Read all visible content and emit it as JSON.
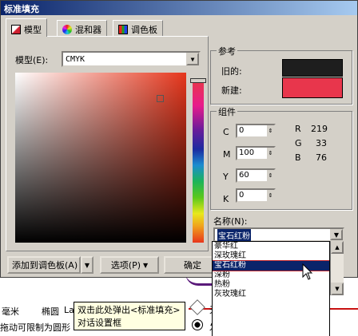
{
  "dialog": {
    "title": "标准填充",
    "tabs": [
      {
        "label": "模型",
        "icon": "model-square-icon"
      },
      {
        "label": "混和器",
        "icon": "mixer-wheel-icon"
      },
      {
        "label": "调色板",
        "icon": "palette-grid-icon"
      }
    ],
    "model": {
      "label": "模型(E):",
      "value": "CMYK",
      "field_base_color": "#e6361c",
      "picker_position": {
        "saturation": 0.82,
        "brightness": 0.85
      }
    },
    "reference": {
      "legend": "参考",
      "old_label": "旧的:",
      "old_color": "#1e1e1e",
      "new_label": "新建:",
      "new_color": "#e8364c"
    },
    "components": {
      "legend": "组件",
      "fields": [
        {
          "label": "C",
          "value": "0"
        },
        {
          "label": "M",
          "value": "100"
        },
        {
          "label": "Y",
          "value": "60"
        },
        {
          "label": "K",
          "value": "0"
        }
      ],
      "rgb": [
        {
          "label": "R",
          "value": "219"
        },
        {
          "label": "G",
          "value": "33"
        },
        {
          "label": "B",
          "value": "76"
        }
      ]
    },
    "name": {
      "label": "名称(N):",
      "value": "宝石红粉",
      "options": [
        "豪华红",
        "深玫瑰红",
        "宝石红粉",
        "深粉",
        "热粉",
        "灰玫瑰红"
      ],
      "selected_index": 2
    },
    "buttons": {
      "add_palette": "添加到调色板(A)",
      "options": "选项(P)",
      "ok": "确定"
    }
  },
  "background": {
    "row1": [
      "毫米",
      "椭圆",
      "La"
    ],
    "row2": "拖动可限制为圆形",
    "right1": "无",
    "right2": "发丝"
  },
  "tooltip": {
    "line1": "双击此处弹出<标准填充>",
    "line2": "对话设置框"
  }
}
